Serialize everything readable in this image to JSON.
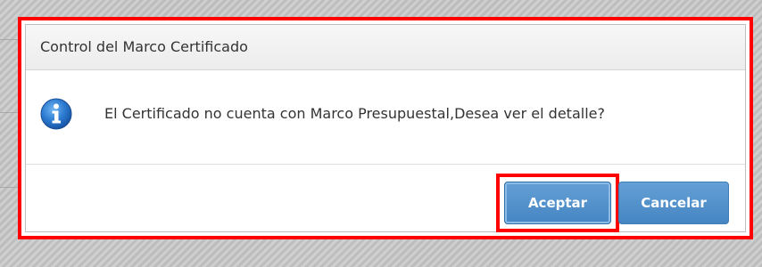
{
  "dialog": {
    "title": "Control del Marco Certificado",
    "icon": "info-icon",
    "message": "El Certificado no cuenta con Marco Presupuestal,Desea ver el detalle?",
    "buttons": {
      "accept_label": "Aceptar",
      "cancel_label": "Cancelar"
    }
  },
  "colors": {
    "highlight": "#ff0000",
    "button": "#4f8fcb",
    "icon": "#1f6fc5"
  }
}
